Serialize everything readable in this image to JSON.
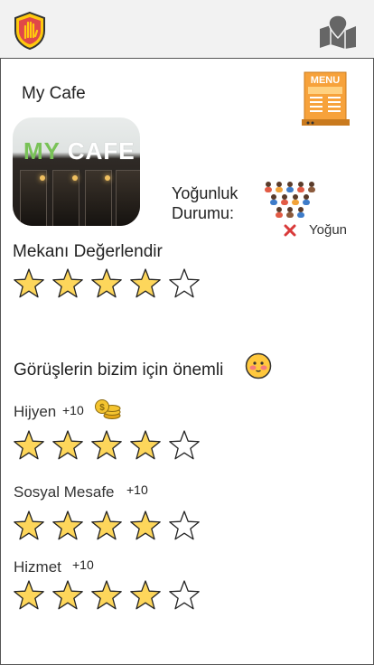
{
  "header": {
    "logo_icon": "shield-hand-icon",
    "map_icon": "map-pin-icon"
  },
  "venue": {
    "name": "My Cafe",
    "menu_icon": "menu-board-icon",
    "photo_sign": "MY CAFE"
  },
  "crowd": {
    "label_line1": "Yoğunluk",
    "label_line2": "Durumu:",
    "status": "Yoğun",
    "status_icon": "x-icon"
  },
  "rate_place": {
    "title": "Mekanı Değerlendir",
    "rating": 4,
    "max": 5
  },
  "feedback": {
    "title": "Görüşlerin bizim için önemli",
    "emoji_icon": "blush-face-icon"
  },
  "criteria": [
    {
      "label": "Hijyen",
      "points": "+10",
      "rating": 4,
      "max": 5,
      "icon": "coins-icon"
    },
    {
      "label": "Sosyal Mesafe",
      "points": "+10",
      "rating": 4,
      "max": 5
    },
    {
      "label": "Hizmet",
      "points": "+10",
      "rating": 4,
      "max": 5
    }
  ],
  "colors": {
    "star_fill": "#FDD65B",
    "star_outline": "#222222",
    "accent_orange": "#F08A24"
  }
}
